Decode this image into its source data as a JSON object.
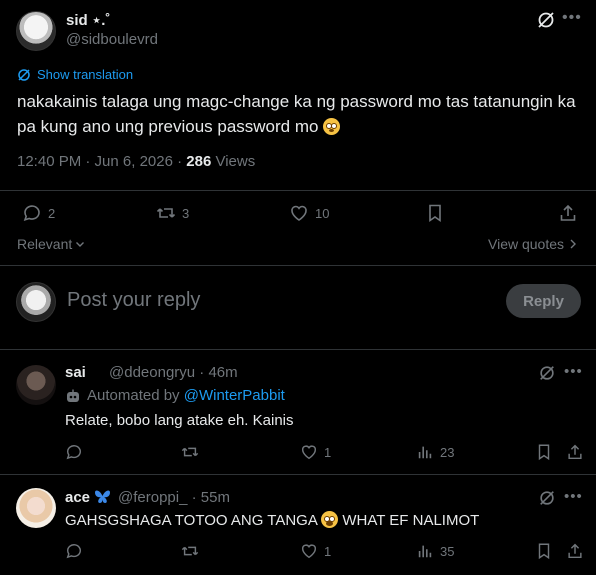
{
  "tweet": {
    "author_name": "sid ⋆.˚",
    "author_handle": "@sidboulevrd",
    "show_translation": "Show translation",
    "text": "nakakainis talaga ung magc-change ka ng password mo tas tatanungin ka pa kung ano ung previous password mo",
    "timestamp": "12:40 PM · Jun 6, 2026 · ",
    "views_count": "286",
    "views_label": " Views",
    "replies": "2",
    "reposts": "3",
    "likes": "10"
  },
  "sort": {
    "label": "Relevant",
    "view_quotes": "View quotes"
  },
  "composer": {
    "placeholder": "Post your reply",
    "button": "Reply"
  },
  "replies": [
    {
      "name": "sai",
      "handle": "@ddeongryu · 46m",
      "automated_prefix": "Automated by ",
      "automated_by": "@WinterPabbit",
      "text": "Relate, bobo lang atake eh. Kainis",
      "replies": "",
      "reposts": "",
      "likes": "1",
      "views": "23"
    },
    {
      "name": "ace",
      "handle": "@feroppi_ · 55m",
      "text_before": "GAHSGSHAGA TOTOO ANG TANGA ",
      "text_after": " WHAT EF NALIMOT",
      "replies": "",
      "reposts": "",
      "likes": "1",
      "views": "35"
    }
  ],
  "colors": {
    "background": "#000000",
    "text": "#e7e9ea",
    "secondary": "#71767b",
    "accent": "#1d9bf0",
    "divider": "#2f3336"
  }
}
